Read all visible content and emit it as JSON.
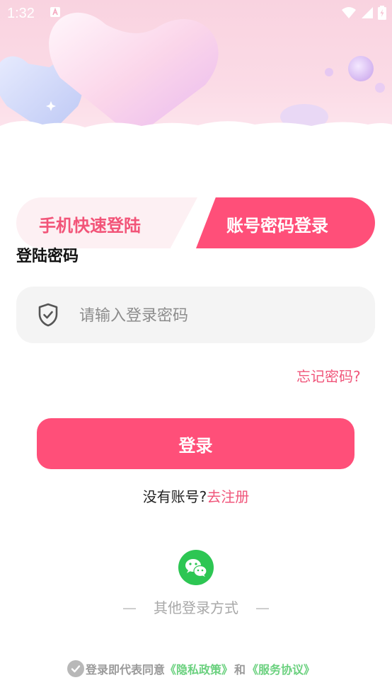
{
  "status_bar": {
    "time": "1:32"
  },
  "tabs": {
    "quick_login": "手机快速登陆",
    "password_login": "账号密码登录"
  },
  "form": {
    "section_label": "登陆密码",
    "password_placeholder": "请输入登录密码",
    "forgot": "忘记密码?",
    "login_button": "登录"
  },
  "register": {
    "prefix": "没有账号?",
    "link": "去注册"
  },
  "other_login": {
    "label": "其他登录方式",
    "dash": "—"
  },
  "agreement": {
    "prefix": "登录即代表同意",
    "privacy": "《隐私政策》",
    "and": "和",
    "service": "《服务协议》"
  },
  "colors": {
    "accent": "#ff4f79",
    "wechat": "#2dc653",
    "policy": "#6bd17f"
  },
  "icons": [
    "shield-icon",
    "wechat-icon",
    "check-icon",
    "wifi-icon",
    "signal-icon",
    "battery-icon"
  ]
}
